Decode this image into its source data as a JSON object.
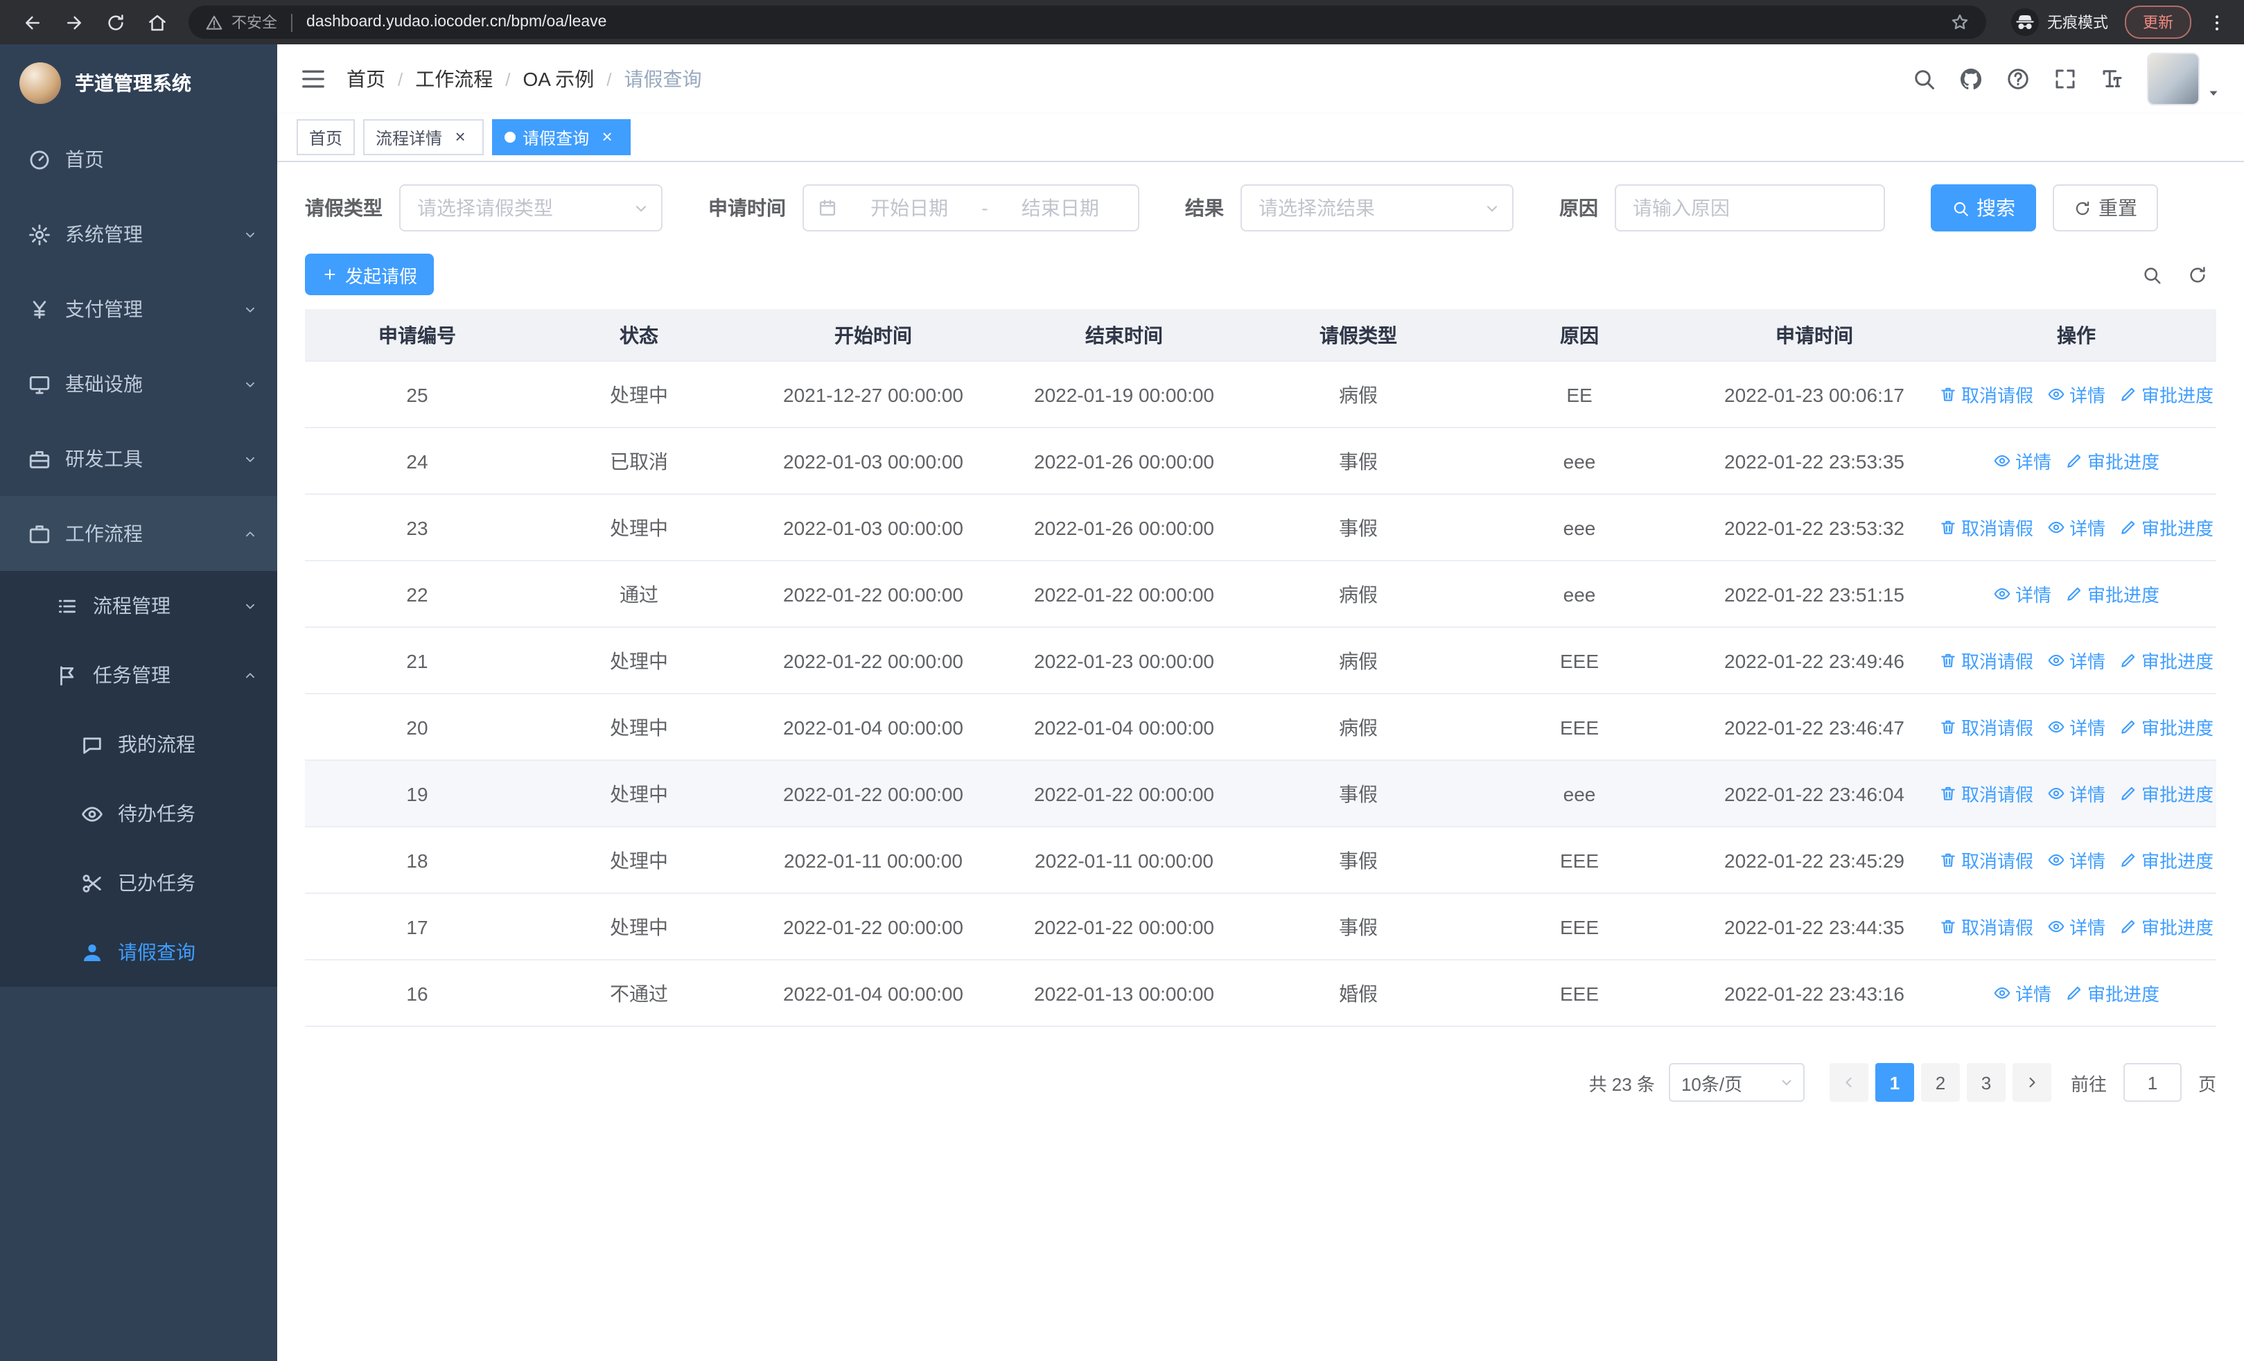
{
  "browser": {
    "security_label": "不安全",
    "url": "dashboard.yudao.iocoder.cn/bpm/oa/leave",
    "incognito_label": "无痕模式",
    "update_label": "更新"
  },
  "sidebar": {
    "logo_title": "芋道管理系统",
    "menu": [
      {
        "label": "首页",
        "icon": "dashboard-icon",
        "level": 1
      },
      {
        "label": "系统管理",
        "icon": "gear-icon",
        "level": 1,
        "state": "collapsed"
      },
      {
        "label": "支付管理",
        "icon": "yen-icon",
        "level": 1,
        "state": "collapsed"
      },
      {
        "label": "基础设施",
        "icon": "monitor-icon",
        "level": 1,
        "state": "collapsed"
      },
      {
        "label": "研发工具",
        "icon": "toolbox-icon",
        "level": 1,
        "state": "collapsed"
      },
      {
        "label": "工作流程",
        "icon": "briefcase-icon",
        "level": 1,
        "state": "expanded",
        "highlight": true
      },
      {
        "label": "流程管理",
        "icon": "list-icon",
        "level": 2,
        "state": "collapsed"
      },
      {
        "label": "任务管理",
        "icon": "flag-icon",
        "level": 2,
        "state": "expanded"
      },
      {
        "label": "我的流程",
        "icon": "message-icon",
        "level": 3
      },
      {
        "label": "待办任务",
        "icon": "eye-icon",
        "level": 3
      },
      {
        "label": "已办任务",
        "icon": "scissors-icon",
        "level": 3
      },
      {
        "label": "请假查询",
        "icon": "user-icon",
        "level": 3,
        "active": true
      }
    ]
  },
  "header": {
    "breadcrumb": [
      {
        "label": "首页"
      },
      {
        "label": "工作流程"
      },
      {
        "label": "OA 示例"
      },
      {
        "label": "请假查询",
        "current": true
      }
    ]
  },
  "tags": [
    {
      "label": "首页",
      "closable": false,
      "active": false
    },
    {
      "label": "流程详情",
      "closable": true,
      "active": false
    },
    {
      "label": "请假查询",
      "closable": true,
      "active": true
    }
  ],
  "filters": {
    "leave_type_label": "请假类型",
    "leave_type_placeholder": "请选择请假类型",
    "apply_time_label": "申请时间",
    "start_placeholder": "开始日期",
    "range_separator": "-",
    "end_placeholder": "结束日期",
    "result_label": "结果",
    "result_placeholder": "请选择流结果",
    "reason_label": "原因",
    "reason_placeholder": "请输入原因",
    "search_label": "搜索",
    "reset_label": "重置"
  },
  "toolbar": {
    "create_label": "发起请假"
  },
  "table": {
    "columns": [
      "申请编号",
      "状态",
      "开始时间",
      "结束时间",
      "请假类型",
      "原因",
      "申请时间",
      "操作"
    ],
    "action_defs": {
      "cancel": {
        "label": "取消请假",
        "icon": "trash-icon"
      },
      "detail": {
        "label": "详情",
        "icon": "eye-icon"
      },
      "progress": {
        "label": "审批进度",
        "icon": "edit-icon"
      }
    },
    "rows": [
      {
        "id": "25",
        "status": "处理中",
        "start": "2021-12-27 00:00:00",
        "end": "2022-01-19 00:00:00",
        "type": "病假",
        "reason": "EE",
        "apply_time": "2022-01-23 00:06:17",
        "actions": [
          "cancel",
          "detail",
          "progress"
        ]
      },
      {
        "id": "24",
        "status": "已取消",
        "start": "2022-01-03 00:00:00",
        "end": "2022-01-26 00:00:00",
        "type": "事假",
        "reason": "eee",
        "apply_time": "2022-01-22 23:53:35",
        "actions": [
          "detail",
          "progress"
        ]
      },
      {
        "id": "23",
        "status": "处理中",
        "start": "2022-01-03 00:00:00",
        "end": "2022-01-26 00:00:00",
        "type": "事假",
        "reason": "eee",
        "apply_time": "2022-01-22 23:53:32",
        "actions": [
          "cancel",
          "detail",
          "progress"
        ]
      },
      {
        "id": "22",
        "status": "通过",
        "start": "2022-01-22 00:00:00",
        "end": "2022-01-22 00:00:00",
        "type": "病假",
        "reason": "eee",
        "apply_time": "2022-01-22 23:51:15",
        "actions": [
          "detail",
          "progress"
        ]
      },
      {
        "id": "21",
        "status": "处理中",
        "start": "2022-01-22 00:00:00",
        "end": "2022-01-23 00:00:00",
        "type": "病假",
        "reason": "EEE",
        "apply_time": "2022-01-22 23:49:46",
        "actions": [
          "cancel",
          "detail",
          "progress"
        ]
      },
      {
        "id": "20",
        "status": "处理中",
        "start": "2022-01-04 00:00:00",
        "end": "2022-01-04 00:00:00",
        "type": "病假",
        "reason": "EEE",
        "apply_time": "2022-01-22 23:46:47",
        "actions": [
          "cancel",
          "detail",
          "progress"
        ]
      },
      {
        "id": "19",
        "status": "处理中",
        "start": "2022-01-22 00:00:00",
        "end": "2022-01-22 00:00:00",
        "type": "事假",
        "reason": "eee",
        "apply_time": "2022-01-22 23:46:04",
        "actions": [
          "cancel",
          "detail",
          "progress"
        ],
        "hovered": true
      },
      {
        "id": "18",
        "status": "处理中",
        "start": "2022-01-11 00:00:00",
        "end": "2022-01-11 00:00:00",
        "type": "事假",
        "reason": "EEE",
        "apply_time": "2022-01-22 23:45:29",
        "actions": [
          "cancel",
          "detail",
          "progress"
        ]
      },
      {
        "id": "17",
        "status": "处理中",
        "start": "2022-01-22 00:00:00",
        "end": "2022-01-22 00:00:00",
        "type": "事假",
        "reason": "EEE",
        "apply_time": "2022-01-22 23:44:35",
        "actions": [
          "cancel",
          "detail",
          "progress"
        ]
      },
      {
        "id": "16",
        "status": "不通过",
        "start": "2022-01-04 00:00:00",
        "end": "2022-01-13 00:00:00",
        "type": "婚假",
        "reason": "EEE",
        "apply_time": "2022-01-22 23:43:16",
        "actions": [
          "detail",
          "progress"
        ]
      }
    ]
  },
  "pagination": {
    "total_label": "共 23 条",
    "page_size_label": "10条/页",
    "pages": [
      "1",
      "2",
      "3"
    ],
    "active_page": "1",
    "goto_label": "前往",
    "goto_value": "1",
    "page_unit_label": "页"
  }
}
